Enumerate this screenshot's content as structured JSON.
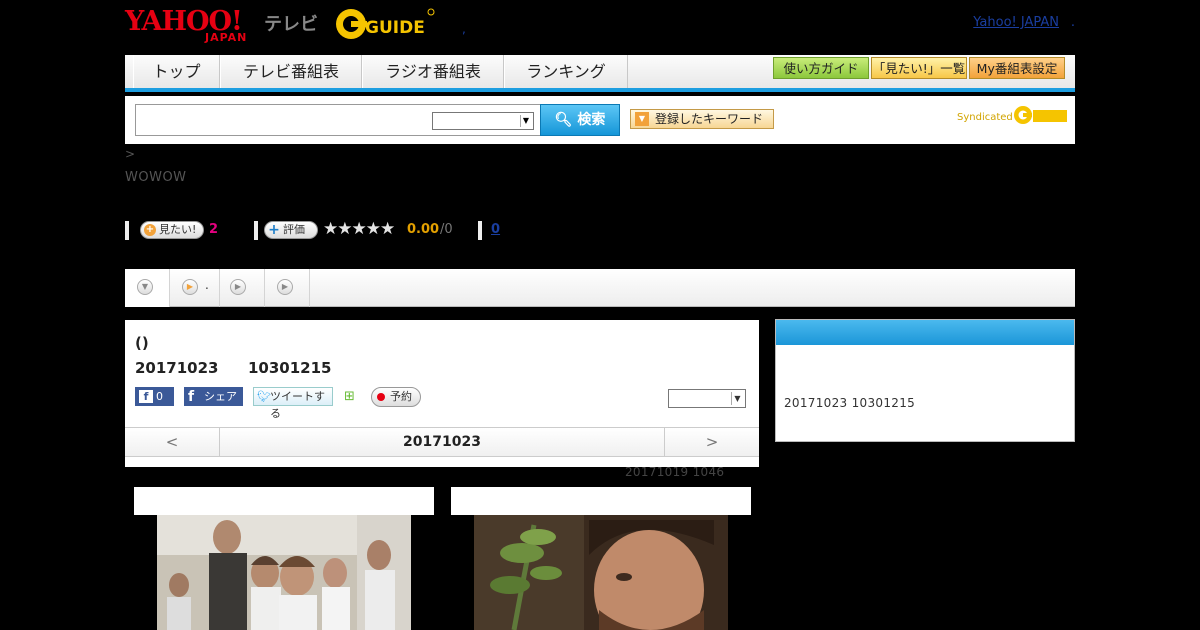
{
  "header": {
    "yahoo_logo_text": "YAHOO!",
    "yahoo_logo_sub": "JAPAN",
    "tv_label": "テレビ",
    "gguide_logo_text": "GUIDE",
    "separator_dot": ",",
    "yahoo_japan_link": "Yahoo! JAPAN",
    "yahoo_japan_link_suffix": "."
  },
  "nav": {
    "tabs": [
      "トップ",
      "テレビ番組表",
      "ラジオ番組表",
      "ランキング"
    ],
    "right_buttons": [
      "使い方ガイド",
      "「見たい!」一覧",
      "My番組表設定"
    ]
  },
  "search": {
    "input_value": "",
    "select_value": "",
    "button_label": "検索",
    "keyword_button_label": "登録したキーワード",
    "syndicated_label": "Syndicated"
  },
  "breadcrumb": ">",
  "channel": "WOWOW",
  "rating": {
    "want_label": "見たい!",
    "want_count": "2",
    "rate_label": "評価",
    "stars": "★★★★★",
    "score": "0.00",
    "score_total": "/0",
    "review_count": "0"
  },
  "tabs": {
    "tab2_label": "."
  },
  "program": {
    "title": "()",
    "date": "20171023",
    "time": "10301215",
    "fb_like_count": "0",
    "fb_share_label": "シェア",
    "tweet_label": "ツイートする",
    "reserve_label": "予約",
    "select_value": "",
    "nav_prev": "<",
    "nav_current": "20171023",
    "nav_next": ">",
    "updated": "20171019  1046"
  },
  "side": {
    "text": "20171023  10301215"
  },
  "colors": {
    "accent_blue": "#1d9ee0",
    "yahoo_red": "#e60012",
    "gguide_yellow": "#f5c400",
    "want_pink": "#e4007f",
    "score_gold": "#e3a000"
  }
}
